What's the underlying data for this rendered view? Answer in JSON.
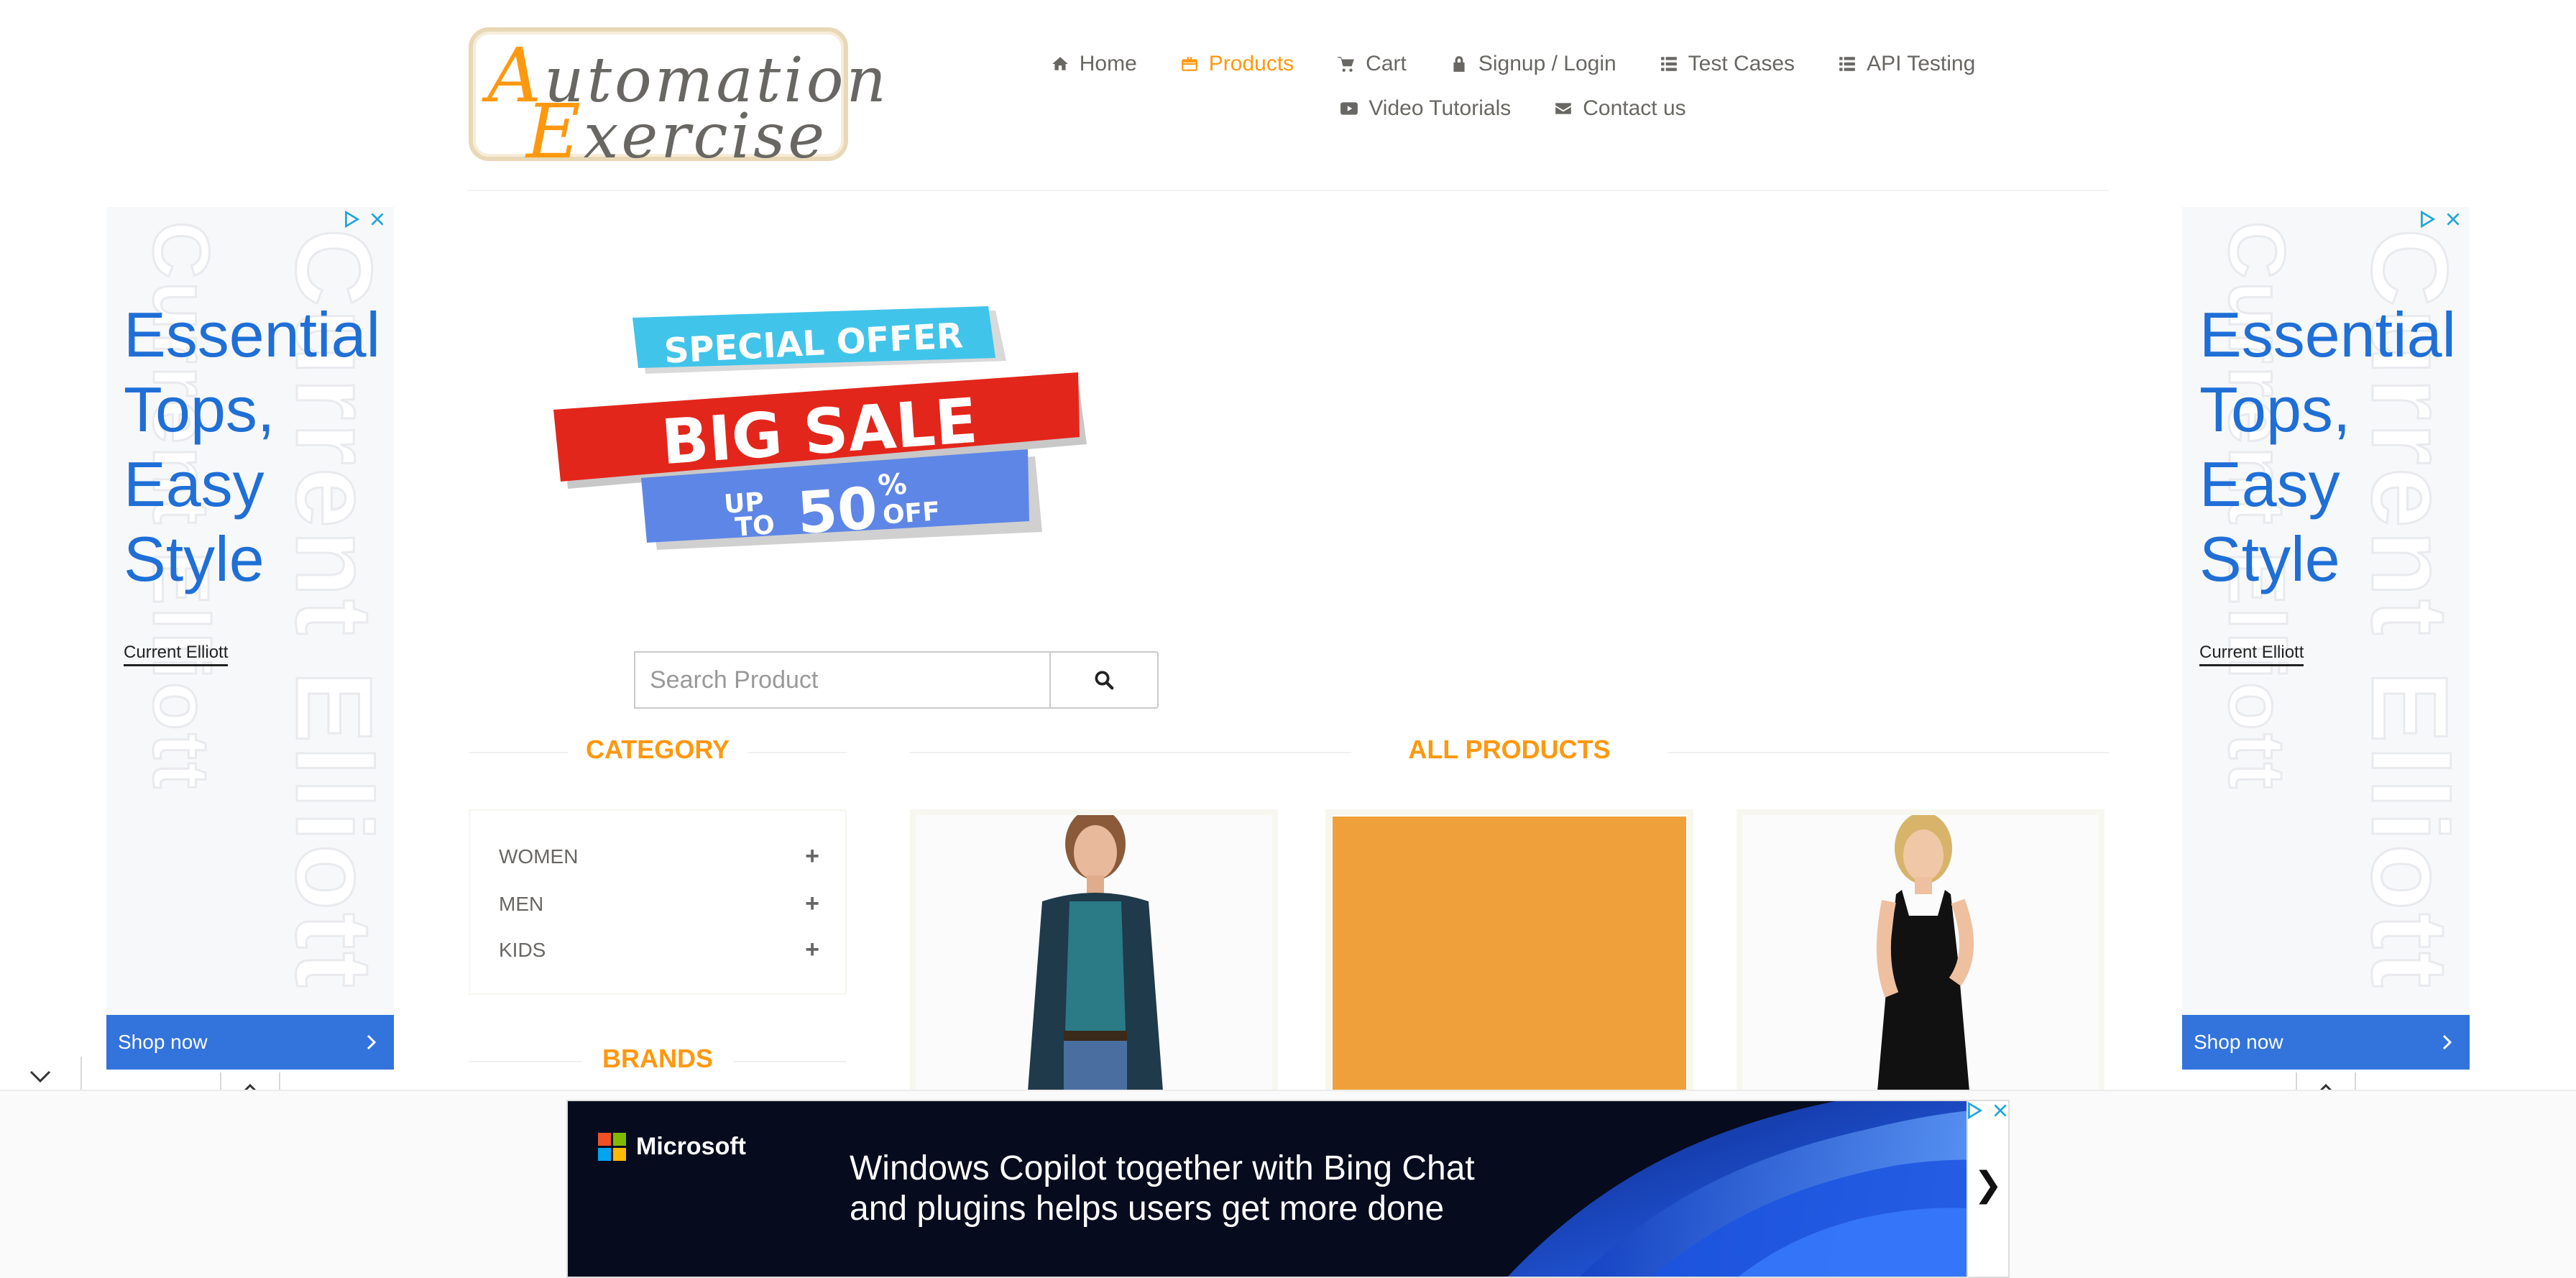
{
  "logo": {
    "line1_cap": "A",
    "line1_rest": "utomation",
    "line2_cap": "E",
    "line2_rest": "xercise"
  },
  "nav": {
    "items": [
      {
        "label": "Home",
        "icon": "home-icon"
      },
      {
        "label": "Products",
        "icon": "briefcase-icon",
        "active": true
      },
      {
        "label": "Cart",
        "icon": "cart-icon"
      },
      {
        "label": "Signup / Login",
        "icon": "lock-icon"
      },
      {
        "label": "Test Cases",
        "icon": "list-icon"
      },
      {
        "label": "API Testing",
        "icon": "list-icon"
      },
      {
        "label": "Video Tutorials",
        "icon": "youtube-icon"
      },
      {
        "label": "Contact us",
        "icon": "envelope-icon"
      }
    ]
  },
  "side_ad": {
    "headline_lines": [
      "Essential",
      "Tops,",
      "Easy",
      "Style"
    ],
    "brand": "Current Elliott",
    "background_text": "Current Elliott",
    "cta": "Shop now"
  },
  "banner": {
    "line1": "SPECIAL OFFER",
    "line2": "BIG SALE",
    "up": "UP",
    "to": "TO",
    "percent_value": "50",
    "percent_sign": "%",
    "off": "OFF"
  },
  "search": {
    "placeholder": "Search Product"
  },
  "sidebar": {
    "category_title": "CATEGORY",
    "categories": [
      {
        "label": "WOMEN"
      },
      {
        "label": "MEN"
      },
      {
        "label": "KIDS"
      }
    ],
    "brands_title": "BRANDS"
  },
  "main": {
    "title": "ALL PRODUCTS"
  },
  "bottom_ad": {
    "brand": "Microsoft",
    "headline_line1": "Windows Copilot together with Bing Chat",
    "headline_line2": "and plugins helps users get more done",
    "arrow": "❯"
  },
  "colors": {
    "accent": "#fe980f",
    "ad_blue": "#1f6fd6",
    "shop_button": "#3373dc",
    "product_placeholder": "#f0a03a"
  }
}
